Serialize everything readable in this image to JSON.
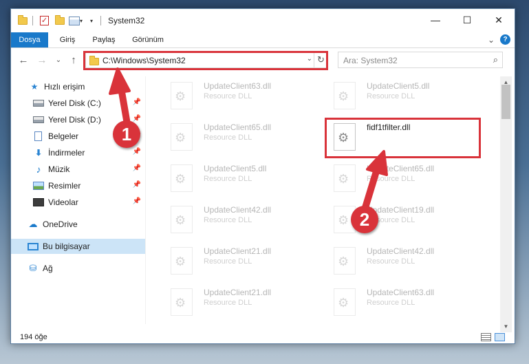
{
  "window": {
    "title": "System32",
    "controls": {
      "minimize": "—",
      "maximize": "☐",
      "close": "✕"
    }
  },
  "ribbon": {
    "tabs": [
      "Dosya",
      "Giriş",
      "Paylaş",
      "Görünüm"
    ],
    "help": "?",
    "expand": "⌄"
  },
  "navigation": {
    "back": "←",
    "forward": "→",
    "recent": "⌄",
    "up": "↑",
    "address": "C:\\Windows\\System32",
    "address_dropdown": "⌄",
    "refresh": "↻",
    "search_placeholder": "Ara: System32",
    "search_icon": "⌕"
  },
  "sidebar": {
    "items": [
      {
        "label": "Hızlı erişim",
        "icon": "star-icon",
        "glyph": "★",
        "pinned": false
      },
      {
        "label": "Yerel Disk (C:)",
        "icon": "drive-icon",
        "glyph": "",
        "pinned": true
      },
      {
        "label": "Yerel Disk (D:)",
        "icon": "drive-icon",
        "glyph": "",
        "pinned": true
      },
      {
        "label": "Belgeler",
        "icon": "document-icon",
        "glyph": "",
        "pinned": true
      },
      {
        "label": "İndirmeler",
        "icon": "download-icon",
        "glyph": "⬇",
        "pinned": true
      },
      {
        "label": "Müzik",
        "icon": "music-icon",
        "glyph": "♪",
        "pinned": true
      },
      {
        "label": "Resimler",
        "icon": "pictures-icon",
        "glyph": "",
        "pinned": true
      },
      {
        "label": "Videolar",
        "icon": "video-icon",
        "glyph": "",
        "pinned": true
      },
      {
        "label": "OneDrive",
        "icon": "cloud-icon",
        "glyph": "☁",
        "pinned": false
      },
      {
        "label": "Bu bilgisayar",
        "icon": "computer-icon",
        "glyph": "",
        "pinned": false,
        "selected": true
      },
      {
        "label": "Ağ",
        "icon": "network-icon",
        "glyph": "⛁",
        "pinned": false
      }
    ],
    "pin_glyph": "📌"
  },
  "files": [
    {
      "name": "UpdateClient63.dll",
      "type": "Resource DLL",
      "faded": true
    },
    {
      "name": "UpdateClient5.dll",
      "type": "Resource DLL",
      "faded": true
    },
    {
      "name": "UpdateClient65.dll",
      "type": "Resource DLL",
      "faded": true
    },
    {
      "name": "fidf1tfilter.dll",
      "type": "",
      "faded": false
    },
    {
      "name": "UpdateClient5.dll",
      "type": "Resource DLL",
      "faded": true
    },
    {
      "name": "UpdateClient65.dll",
      "type": "Resource DLL",
      "faded": true
    },
    {
      "name": "UpdateClient42.dll",
      "type": "Resource DLL",
      "faded": true
    },
    {
      "name": "UpdateClient19.dll",
      "type": "Resource DLL",
      "faded": true
    },
    {
      "name": "UpdateClient21.dll",
      "type": "Resource DLL",
      "faded": true
    },
    {
      "name": "UpdateClient42.dll",
      "type": "Resource DLL",
      "faded": true
    },
    {
      "name": "UpdateClient21.dll",
      "type": "Resource DLL",
      "faded": true
    },
    {
      "name": "UpdateClient63.dll",
      "type": "Resource DLL",
      "faded": true
    }
  ],
  "status": {
    "item_count": "194 öğe"
  },
  "annotations": {
    "step1": "1",
    "step2": "2",
    "color": "#d9333a"
  }
}
